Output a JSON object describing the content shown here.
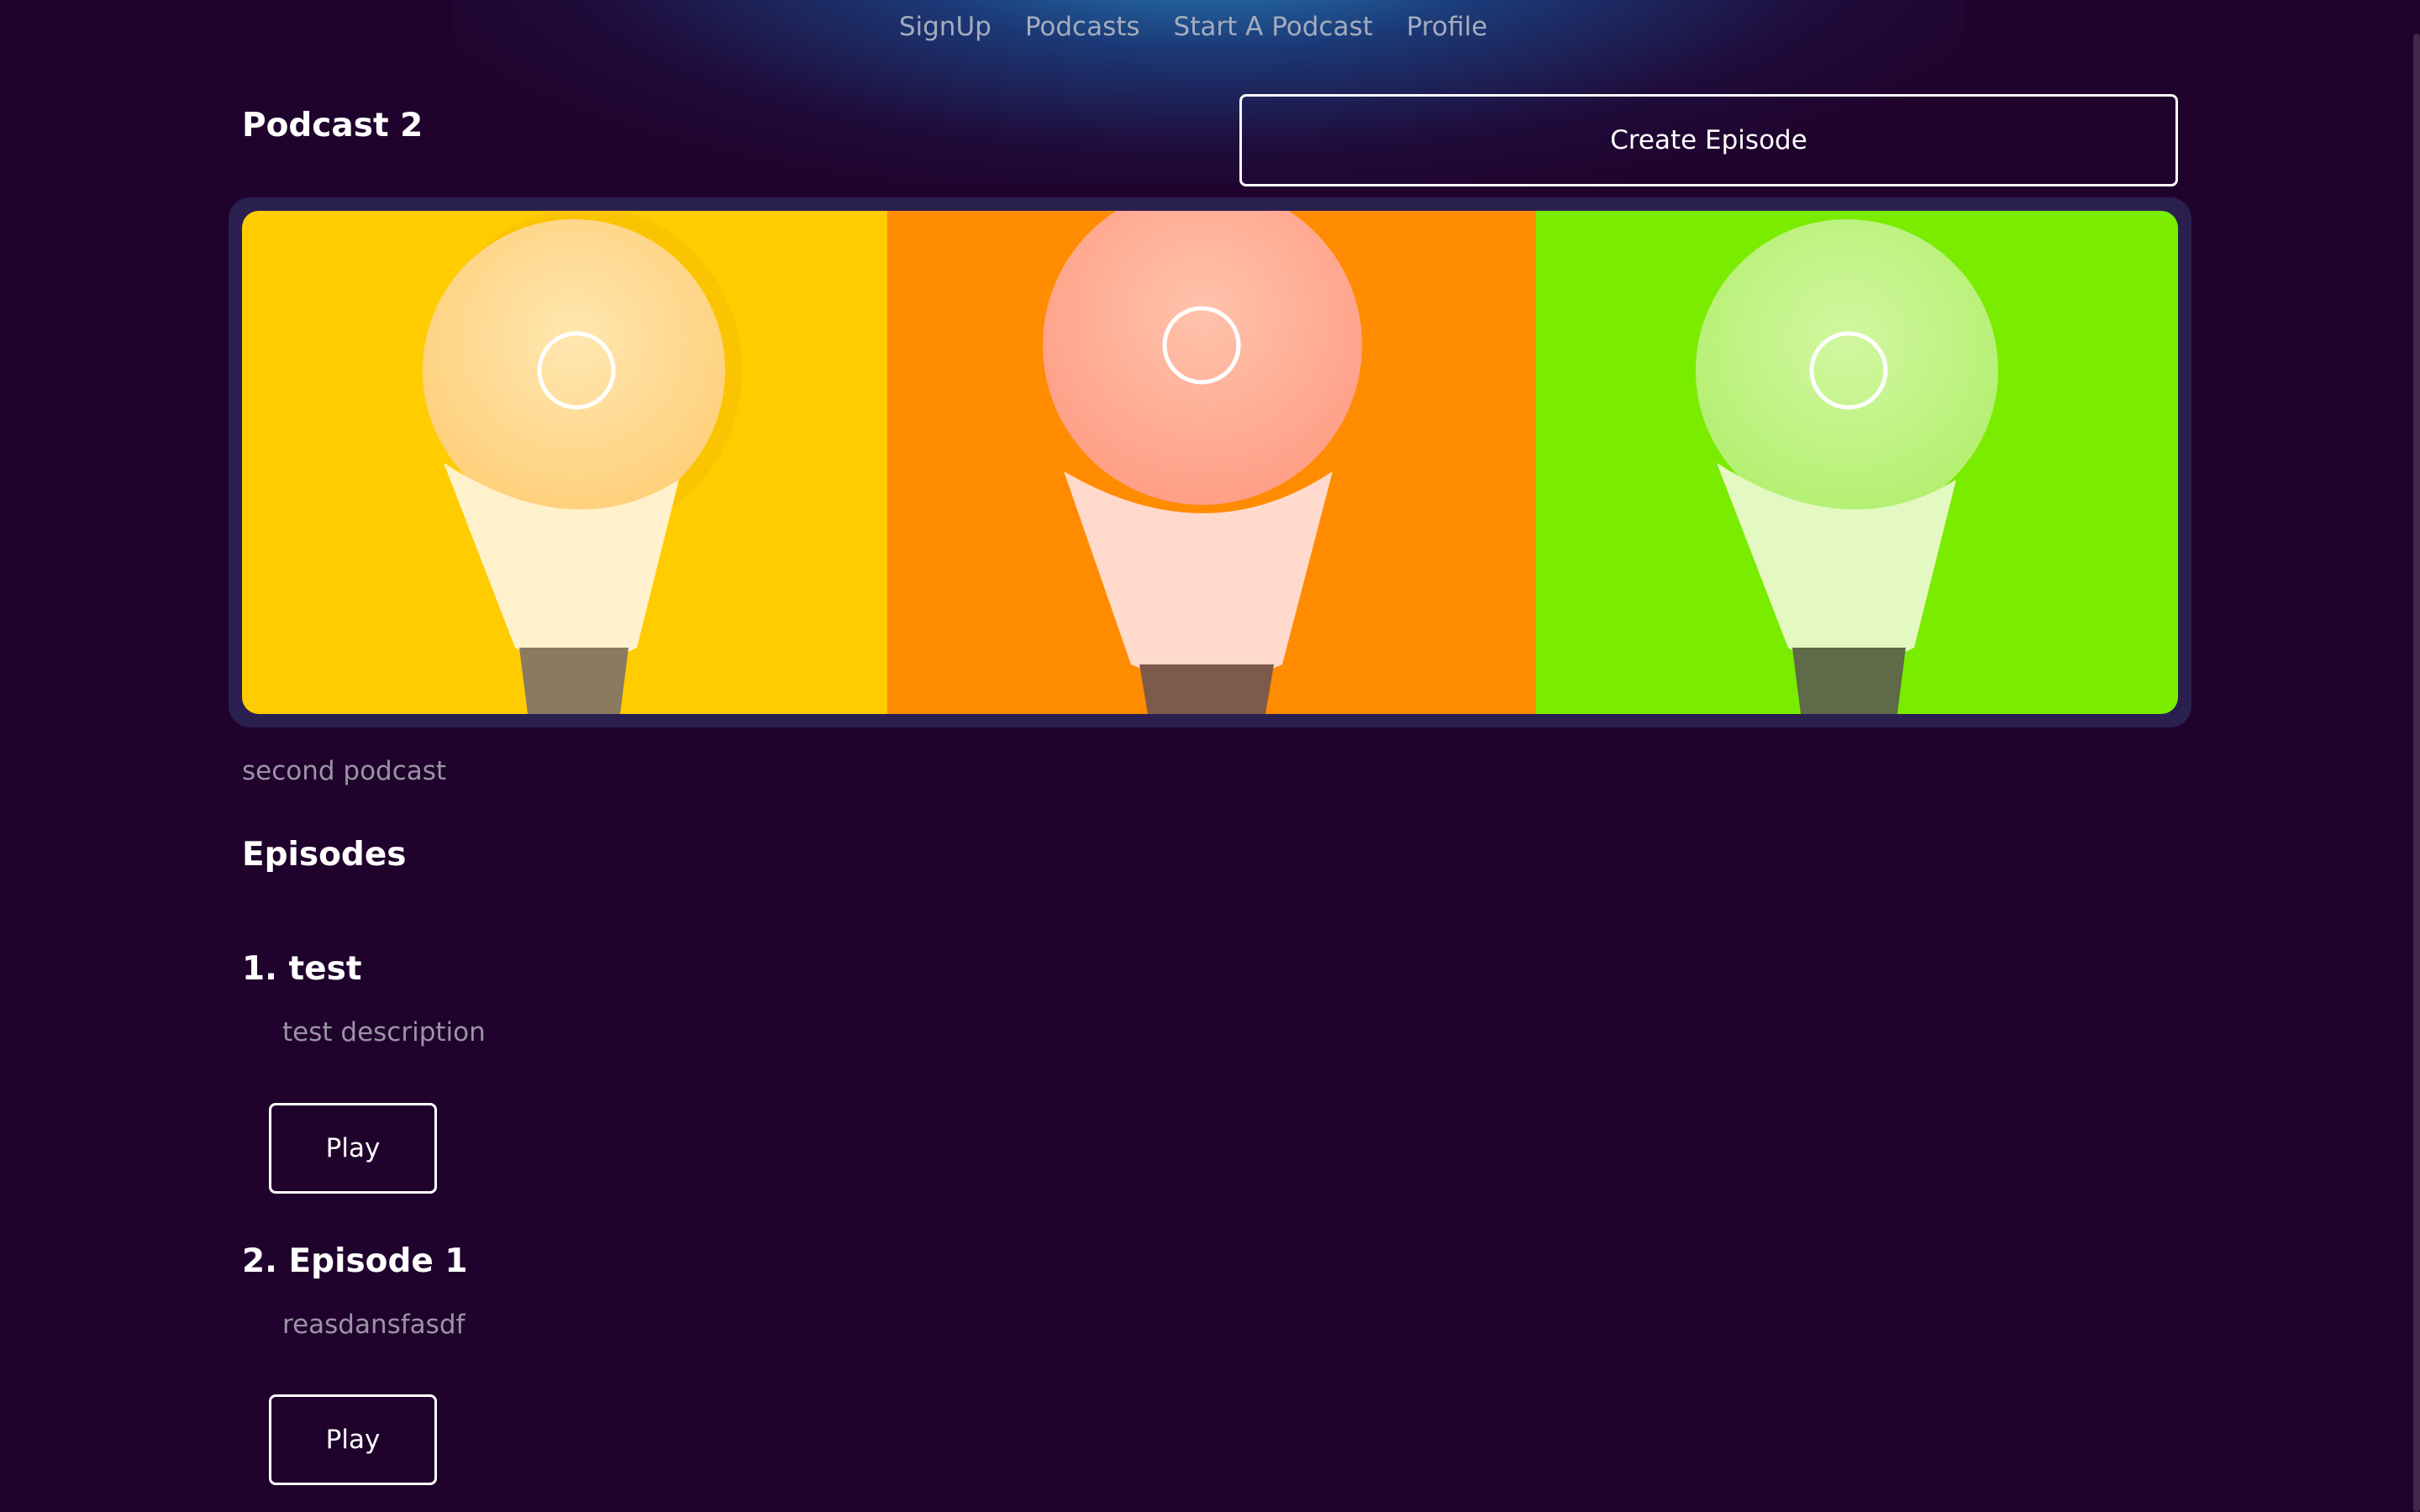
{
  "nav": {
    "items": [
      "SignUp",
      "Podcasts",
      "Start A Podcast",
      "Profile"
    ]
  },
  "podcast": {
    "title": "Podcast 2",
    "create_episode_label": "Create Episode",
    "description": "second podcast",
    "banner_image": "three light bulbs on yellow, orange and green backgrounds"
  },
  "episodes_section": {
    "heading": "Episodes",
    "items": [
      {
        "title": "1. test",
        "description": "test description",
        "play_label": "Play"
      },
      {
        "title": "2. Episode 1",
        "description": "reasdansfasdf",
        "play_label": "Play"
      }
    ]
  },
  "colors": {
    "background": "#20032c",
    "muted_text": "#9a93a6",
    "nav_text": "#a4acbc",
    "banner_frame": "#2a2050",
    "panel_yellow": "#ffcc00",
    "panel_orange": "#ff8c00",
    "panel_green": "#7aec00"
  }
}
